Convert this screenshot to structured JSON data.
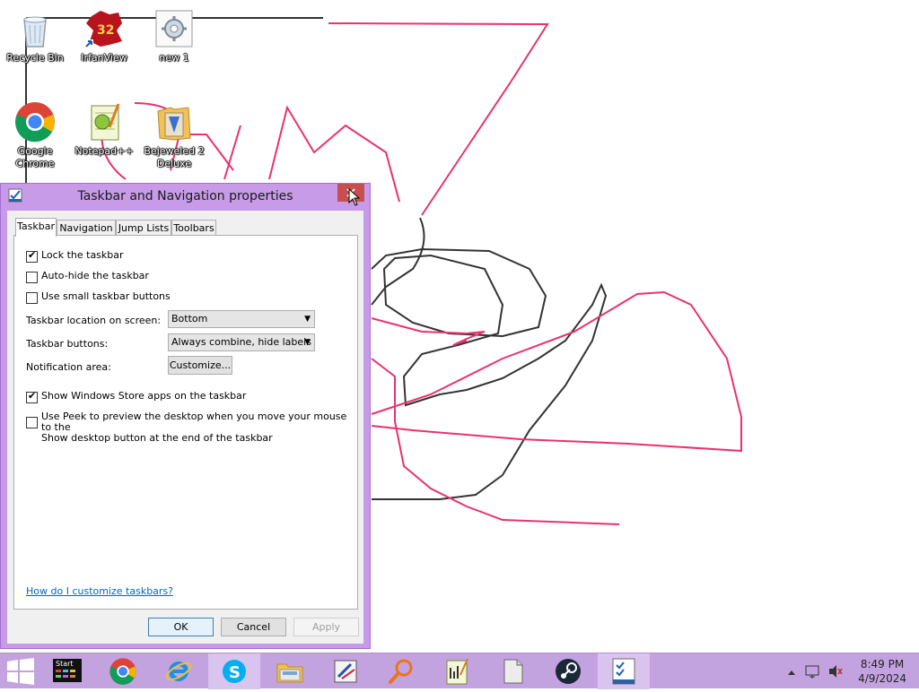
{
  "desktop": {
    "icons": [
      {
        "label": "Recycle Bin",
        "icon": "recycle-bin-icon"
      },
      {
        "label": "IrfanView",
        "icon": "irfanview-icon",
        "badge": "32"
      },
      {
        "label": "new 1",
        "icon": "new-file-icon"
      },
      {
        "label": "Google Chrome",
        "icon": "chrome-icon"
      },
      {
        "label": "Notepad++",
        "icon": "notepad-plus-plus-icon"
      },
      {
        "label": "Bejeweled 2 Deluxe",
        "icon": "bejeweled-icon"
      }
    ]
  },
  "dialog": {
    "title": "Taskbar and Navigation properties",
    "tabs": [
      "Taskbar",
      "Navigation",
      "Jump Lists",
      "Toolbars"
    ],
    "active_tab": "Taskbar",
    "checkboxes": [
      {
        "label": "Lock the taskbar",
        "checked": true
      },
      {
        "label": "Auto-hide the taskbar",
        "checked": false
      },
      {
        "label": "Use small taskbar buttons",
        "checked": false
      }
    ],
    "location_label": "Taskbar location on screen:",
    "location_value": "Bottom",
    "buttons_label": "Taskbar buttons:",
    "buttons_value": "Always combine, hide labels",
    "notification_label": "Notification area:",
    "customize_label": "Customize...",
    "store_apps": {
      "label": "Show Windows Store apps on the taskbar",
      "checked": true
    },
    "peek": {
      "line1": "Use Peek to preview the desktop when you move your mouse to the",
      "line2": "Show desktop button at the end of the taskbar",
      "checked": false
    },
    "help_link": "How do I customize taskbars?",
    "ok": "OK",
    "cancel": "Cancel",
    "apply": "Apply"
  },
  "taskbar": {
    "start_badge": "Start",
    "apps": [
      "windows-start-icon",
      "start-menu-app-icon",
      "chrome-icon",
      "internet-explorer-icon",
      "skype-icon",
      "file-explorer-icon",
      "paint-icon",
      "search-magnifier-icon",
      "notepad-plus-plus-icon",
      "file-icon",
      "steam-icon",
      "taskbar-properties-icon"
    ],
    "time": "8:49 PM",
    "date": "4/9/2024"
  },
  "colors": {
    "accent": "#c79be8",
    "scribble_pink": "#e8326e",
    "scribble_dark": "#333333"
  }
}
